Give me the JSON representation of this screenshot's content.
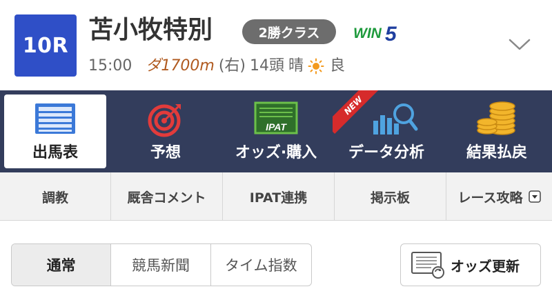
{
  "race": {
    "number": "10R",
    "name": "苫小牧特別",
    "class_badge": "2勝クラス",
    "win5_logo_text": "WIN5",
    "time": "15:00",
    "surface_distance": "ダ1700m",
    "direction": "(右)",
    "runners": "14頭",
    "weather": "晴",
    "track_condition": "良"
  },
  "main_nav": {
    "items": [
      {
        "label": "出馬表",
        "icon": "race-card-icon",
        "active": true
      },
      {
        "label": "予想",
        "icon": "target-icon",
        "active": false
      },
      {
        "label": "オッズ·購入",
        "icon": "ipat-terminal-icon",
        "active": false
      },
      {
        "label": "データ分析",
        "icon": "chart-magnifier-icon",
        "active": false,
        "badge": "NEW"
      },
      {
        "label": "結果払戻",
        "icon": "coins-icon",
        "active": false
      }
    ]
  },
  "sub_tabs": {
    "items": [
      "調教",
      "厩舎コメント",
      "IPAT連携",
      "掲示板",
      "レース攻略"
    ]
  },
  "view_toggle": {
    "options": [
      "通常",
      "競馬新聞",
      "タイム指数"
    ],
    "selected": "通常"
  },
  "odds_update": {
    "label": "オッズ更新"
  },
  "colors": {
    "race_number_bg": "#2f4fc7",
    "nav_bg": "#333d5c",
    "badge_bg": "#6d6d6d",
    "new_ribbon": "#d62b2b",
    "win5_green": "#1e9a3c",
    "win5_blue": "#1f3f9f"
  }
}
